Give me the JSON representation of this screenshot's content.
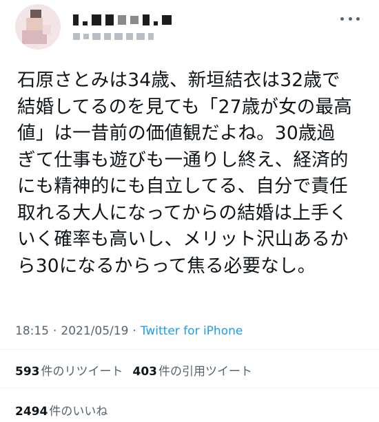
{
  "tweet": {
    "text": "石原さとみは34歳、新垣結衣は32歳で\n結婚してるのを見ても「27歳が女の最高\n値」は一昔前の価値観だよね。30歳過\nぎて仕事も遊びも一通りし終え、経済的\nにも精神的にも自立してる、自分で責任\n取れる大人になってからの結婚は上手く\nいく確率も高いし、メリット沢山あるか\nら30になるからって焦る必要なし。",
    "time": "18:15",
    "sep1": "·",
    "date": "2021/05/19",
    "sep2": "·",
    "source": "Twitter for iPhone"
  },
  "stats": {
    "retweets_count": "593",
    "retweets_label": "件のリツイート",
    "quotes_count": "403",
    "quotes_label": "件の引用ツイート",
    "likes_count": "2494",
    "likes_label": "件のいいね"
  },
  "icons": {
    "more": "more-dots-icon",
    "avatar": "avatar-image"
  },
  "colors": {
    "text": "#0f1419",
    "secondary": "#536471",
    "link": "#1d9bf0",
    "divider": "#eff3f4"
  }
}
